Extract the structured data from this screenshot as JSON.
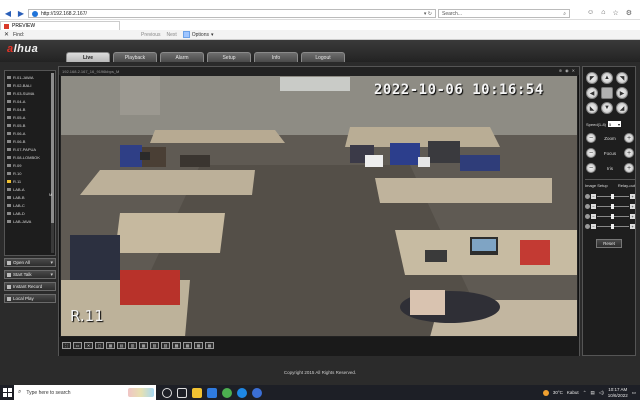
{
  "browser": {
    "url": "http://192.168.2.167/",
    "search_placeholder": "Search...",
    "tab_title": "PREVIEW",
    "find_label": "Find:",
    "find_prev": "Previous",
    "find_next": "Next",
    "find_options": "Options"
  },
  "app": {
    "logo": "alhua",
    "menu": [
      "Live",
      "Playback",
      "Alarm",
      "Setup",
      "Info",
      "Logout"
    ],
    "active_menu": "Live",
    "channels": [
      "R.01-JAWA",
      "R.02-BALI",
      "R.03-SUMA",
      "R.04-A",
      "R.04-B",
      "R.05-A",
      "R.05-B",
      "R.06-A",
      "R.06-B",
      "R.07-PAPUA",
      "R.08-LOMBOK",
      "R.09",
      "R.10",
      "R.11",
      "LAB-A",
      "LAB-B",
      "LAB-C",
      "LAB-D",
      "LAB-JAVA"
    ],
    "active_channel": "R.11",
    "channel_badge": "M",
    "side_buttons": {
      "open_all": "Open All",
      "start_talk": "Start Talk",
      "instant_record": "Instant Record",
      "local_play": "Local Play"
    },
    "video": {
      "topbar_info": "192.168.2.167_16_9196kbps_M",
      "timestamp": "2022-10-06 10:16:54",
      "camera_label": "R.11"
    },
    "ptz": {
      "speed_label": "Speed(1-8)",
      "speed_value": "5",
      "zoom_label": "Zoom",
      "focus_label": "Focus",
      "iris_label": "Iris"
    },
    "image_setup_label": "Image Setup",
    "relay_out_label": "Relay-out",
    "reset_label": "Reset",
    "footer": "Copyright 2015 All Rights Reserved."
  },
  "taskbar": {
    "search_placeholder": "Type here to search",
    "temperature": "30°C",
    "weather": "Kabut",
    "time": "10:17 AM",
    "date": "10/6/2022"
  }
}
